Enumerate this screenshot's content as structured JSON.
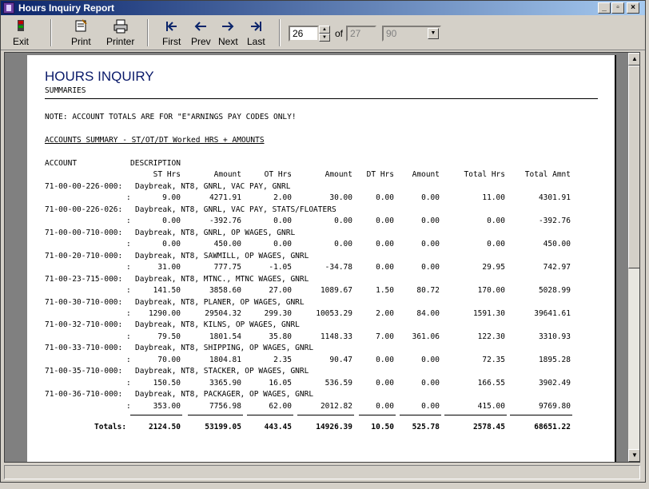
{
  "window": {
    "title": "Hours Inquiry Report"
  },
  "toolbar": {
    "exit": "Exit",
    "print": "Print",
    "printer": "Printer",
    "first": "First",
    "prev": "Prev",
    "next": "Next",
    "last": "Last",
    "page_current": "26",
    "of_label": "of",
    "page_total": "27",
    "zoom": "90"
  },
  "report": {
    "title": "HOURS INQUIRY",
    "section": "SUMMARIES",
    "note": "NOTE: ACCOUNT TOTALS ARE FOR \"E\"ARNINGS PAY CODES ONLY!",
    "summary_heading": "ACCOUNTS SUMMARY - ST/OT/DT Worked HRS + AMOUNTS",
    "col_account": "ACCOUNT",
    "col_description": "DESCRIPTION",
    "headers": [
      "ST Hrs",
      "Amount",
      "OT Hrs",
      "Amount",
      "DT Hrs",
      "Amount",
      "Total Hrs",
      "Total Amnt"
    ],
    "rows": [
      {
        "account": "71-00-00-226-000:",
        "desc": "Daybreak, NT8, GNRL, VAC PAY, GNRL",
        "vals": [
          "9.00",
          "4271.91",
          "2.00",
          "30.00",
          "0.00",
          "0.00",
          "11.00",
          "4301.91"
        ]
      },
      {
        "account": "71-00-00-226-026:",
        "desc": "Daybreak, NT8, GNRL, VAC PAY, STATS/FLOATERS",
        "vals": [
          "0.00",
          "-392.76",
          "0.00",
          "0.00",
          "0.00",
          "0.00",
          "0.00",
          "-392.76"
        ]
      },
      {
        "account": "71-00-00-710-000:",
        "desc": "Daybreak, NT8, GNRL, OP WAGES, GNRL",
        "vals": [
          "0.00",
          "450.00",
          "0.00",
          "0.00",
          "0.00",
          "0.00",
          "0.00",
          "450.00"
        ]
      },
      {
        "account": "71-00-20-710-000:",
        "desc": "Daybreak, NT8, SAWMILL, OP WAGES, GNRL",
        "vals": [
          "31.00",
          "777.75",
          "-1.05",
          "-34.78",
          "0.00",
          "0.00",
          "29.95",
          "742.97"
        ]
      },
      {
        "account": "71-00-23-715-000:",
        "desc": "Daybreak, NT8, MTNC., MTNC WAGES, GNRL",
        "vals": [
          "141.50",
          "3858.60",
          "27.00",
          "1089.67",
          "1.50",
          "80.72",
          "170.00",
          "5028.99"
        ]
      },
      {
        "account": "71-00-30-710-000:",
        "desc": "Daybreak, NT8, PLANER, OP WAGES, GNRL",
        "vals": [
          "1290.00",
          "29504.32",
          "299.30",
          "10053.29",
          "2.00",
          "84.00",
          "1591.30",
          "39641.61"
        ]
      },
      {
        "account": "71-00-32-710-000:",
        "desc": "Daybreak, NT8, KILNS, OP WAGES, GNRL",
        "vals": [
          "79.50",
          "1801.54",
          "35.80",
          "1148.33",
          "7.00",
          "361.06",
          "122.30",
          "3310.93"
        ]
      },
      {
        "account": "71-00-33-710-000:",
        "desc": "Daybreak, NT8, SHIPPING, OP WAGES, GNRL",
        "vals": [
          "70.00",
          "1804.81",
          "2.35",
          "90.47",
          "0.00",
          "0.00",
          "72.35",
          "1895.28"
        ]
      },
      {
        "account": "71-00-35-710-000:",
        "desc": "Daybreak, NT8, STACKER, OP WAGES, GNRL",
        "vals": [
          "150.50",
          "3365.90",
          "16.05",
          "536.59",
          "0.00",
          "0.00",
          "166.55",
          "3902.49"
        ]
      },
      {
        "account": "71-00-36-710-000:",
        "desc": "Daybreak, NT8, PACKAGER, OP WAGES, GNRL",
        "vals": [
          "353.00",
          "7756.98",
          "62.00",
          "2012.82",
          "0.00",
          "0.00",
          "415.00",
          "9769.80"
        ]
      }
    ],
    "totals_label": "Totals:",
    "totals": [
      "2124.50",
      "53199.05",
      "443.45",
      "14926.39",
      "10.50",
      "525.78",
      "2578.45",
      "68651.22"
    ]
  }
}
